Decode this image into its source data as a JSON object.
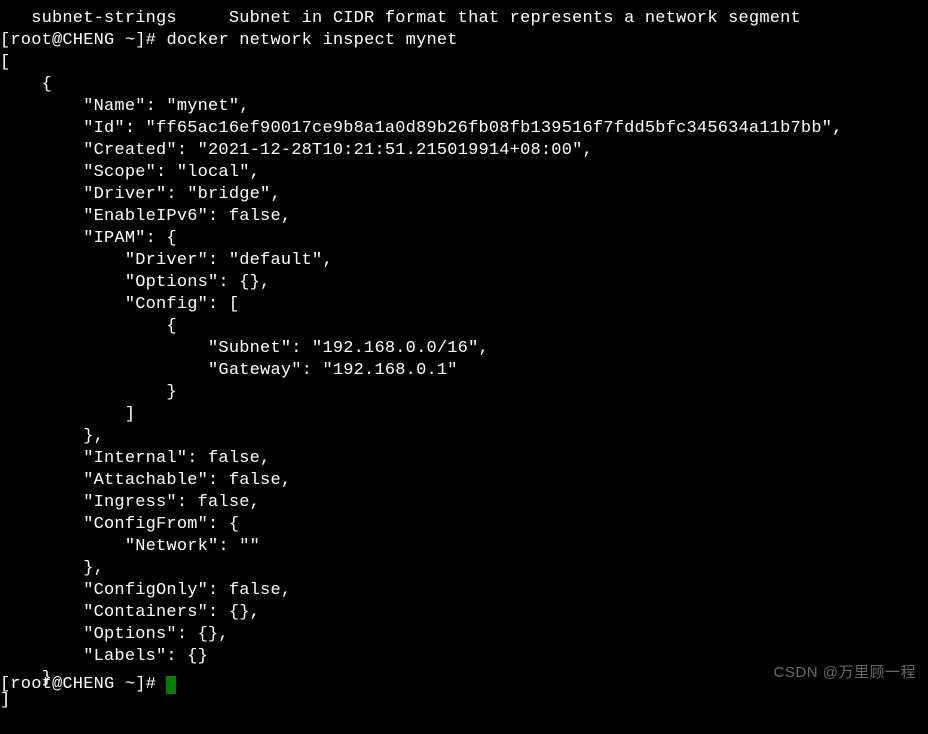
{
  "top_line": "   subnet-strings     Subnet in CIDR format that represents a network segment",
  "prompt": "[root@CHENG ~]# ",
  "command": "docker network inspect mynet",
  "json_output": "[\n    {\n        \"Name\": \"mynet\",\n        \"Id\": \"ff65ac16ef90017ce9b8a1a0d89b26fb08fb139516f7fdd5bfc345634a11b7bb\",\n        \"Created\": \"2021-12-28T10:21:51.215019914+08:00\",\n        \"Scope\": \"local\",\n        \"Driver\": \"bridge\",\n        \"EnableIPv6\": false,\n        \"IPAM\": {\n            \"Driver\": \"default\",\n            \"Options\": {},\n            \"Config\": [\n                {\n                    \"Subnet\": \"192.168.0.0/16\",\n                    \"Gateway\": \"192.168.0.1\"\n                }\n            ]\n        },\n        \"Internal\": false,\n        \"Attachable\": false,\n        \"Ingress\": false,\n        \"ConfigFrom\": {\n            \"Network\": \"\"\n        },\n        \"ConfigOnly\": false,\n        \"Containers\": {},\n        \"Options\": {},\n        \"Labels\": {}\n    }\n]",
  "bottom_prompt": "[root@CHENG ~]# ",
  "watermark": "CSDN @万里顾一程"
}
